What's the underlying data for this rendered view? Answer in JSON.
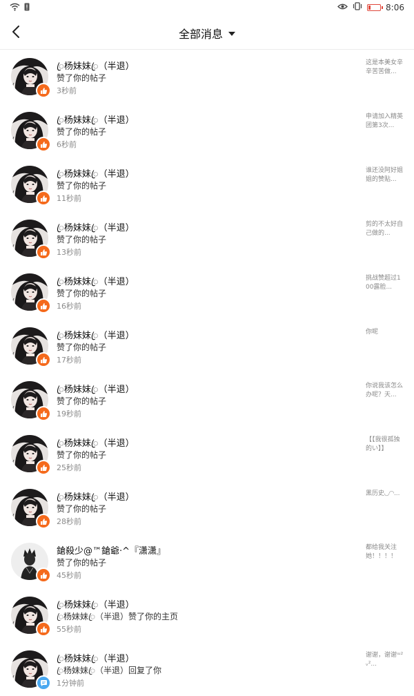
{
  "status_bar": {
    "time": "8:06",
    "left_icons": [
      "wifi-icon",
      "sim-alert-icon"
    ],
    "right_icons": [
      "eye-icon",
      "vibrate-icon",
      "battery-low-icon"
    ]
  },
  "header": {
    "title": "全部消息"
  },
  "notifications": [
    {
      "name": "ꦿ杨妹妹ꦿ（半退）",
      "action": "赞了你的帖子",
      "time": "3秒前",
      "preview": "这是本美女辛辛苦苦做...",
      "avatar": "girl",
      "badge": "like"
    },
    {
      "name": "ꦿ杨妹妹ꦿ（半退）",
      "action": "赞了你的帖子",
      "time": "6秒前",
      "preview": "申请加入精英团第3次...",
      "avatar": "girl",
      "badge": "like"
    },
    {
      "name": "ꦿ杨妹妹ꦿ（半退）",
      "action": "赞了你的帖子",
      "time": "11秒前",
      "preview": "谁还没阿好姐姐的赞贴...",
      "avatar": "girl",
      "badge": "like"
    },
    {
      "name": "ꦿ杨妹妹ꦿ（半退）",
      "action": "赞了你的帖子",
      "time": "13秒前",
      "preview": "剪的不太好自己做的...",
      "avatar": "girl",
      "badge": "like"
    },
    {
      "name": "ꦿ杨妹妹ꦿ（半退）",
      "action": "赞了你的帖子",
      "time": "16秒前",
      "preview": "挑战赞超过100露脸...",
      "avatar": "girl",
      "badge": "like"
    },
    {
      "name": "ꦿ杨妹妹ꦿ（半退）",
      "action": "赞了你的帖子",
      "time": "17秒前",
      "preview": "你呢",
      "avatar": "girl",
      "badge": "like"
    },
    {
      "name": "ꦿ杨妹妹ꦿ（半退）",
      "action": "赞了你的帖子",
      "time": "19秒前",
      "preview": "你说我该怎么办呢？天...",
      "avatar": "girl",
      "badge": "like"
    },
    {
      "name": "ꦿ杨妹妹ꦿ（半退）",
      "action": "赞了你的帖子",
      "time": "25秒前",
      "preview": "【【我很孤独的い】】",
      "avatar": "girl",
      "badge": "like"
    },
    {
      "name": "ꦿ杨妹妹ꦿ（半退）",
      "action": "赞了你的帖子",
      "time": "28秒前",
      "preview": "黑历史◟◞◜◝...",
      "avatar": "girl",
      "badge": "like"
    },
    {
      "name": "鎗殺少@™鎗爺·^『潇潇』",
      "action": "赞了你的帖子",
      "time": "45秒前",
      "preview": "都给我关注她！！！！",
      "avatar": "boy",
      "badge": "like"
    },
    {
      "name": "ꦿ杨妹妹ꦿ（半退）",
      "action": "ꦿ杨妹妹ꦿ（半退）赞了你的主页",
      "time": "55秒前",
      "preview": "",
      "avatar": "girl",
      "badge": "like"
    },
    {
      "name": "ꦿ杨妹妹ꦿ（半退）",
      "action": "ꦿ杨妹妹ꦿ（半退）回复了你",
      "time": "1分钟前",
      "preview": "谢谢，谢谢ᵚ²ᵥ²...",
      "avatar": "girl",
      "badge": "comment"
    }
  ],
  "colors": {
    "like_badge": "#f56a1c",
    "comment_badge": "#4aa8f0",
    "battery": "#e0463a",
    "divider": "#ececec"
  }
}
